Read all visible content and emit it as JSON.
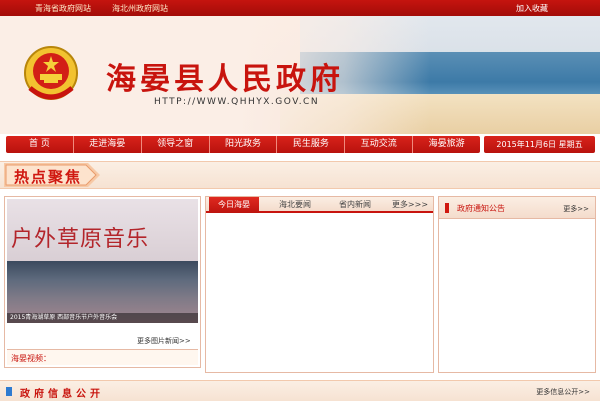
{
  "top_links": {
    "left": [
      "青海省政府网站",
      "海北州政府网站"
    ],
    "right": "加入收藏"
  },
  "header": {
    "title": "海晏县人民政府",
    "url": "HTTP://WWW.QHHYX.GOV.CN"
  },
  "nav": {
    "items": [
      "首 页",
      "走进海晏",
      "领导之窗",
      "阳光政务",
      "民生服务",
      "互动交流",
      "海晏旅游"
    ],
    "date": "2015年11月6日 星期五"
  },
  "hot_focus": {
    "title": "热点聚焦"
  },
  "left_panel": {
    "photo_banner_text": "户外草原音乐",
    "photo_caption": "2015青海湖草原 西部音乐节户外音乐会",
    "more_photos": "更多图片新闻>>",
    "video_label": "海晏视频："
  },
  "middle_panel": {
    "tabs": [
      "今日海晏",
      "海北要闻",
      "省内新闻",
      "更多>>>"
    ],
    "active_tab": "今日海晏"
  },
  "right_panel": {
    "title": "政府通知公告",
    "more": "更多>>"
  },
  "bottom": {
    "title": "政府信息公开",
    "more": "更多信息公开>>"
  },
  "colors": {
    "brand_red": "#c8140e",
    "accent_blue": "#2f7bd0"
  }
}
